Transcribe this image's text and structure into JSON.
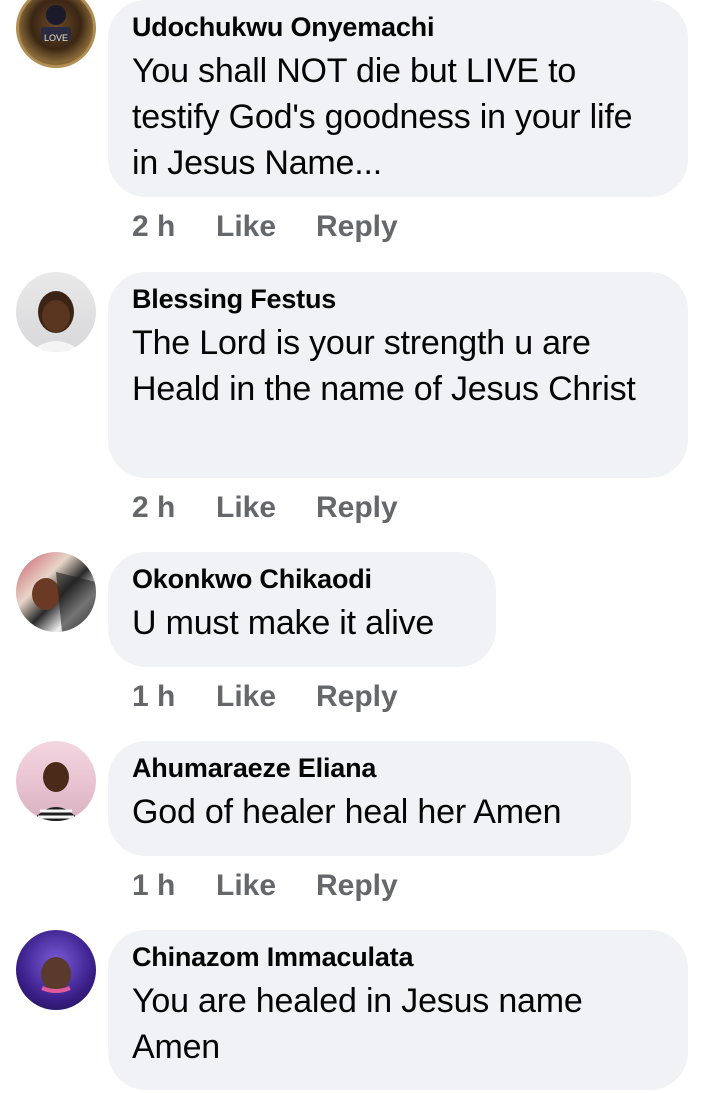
{
  "comments": [
    {
      "author": "Udochukwu Onyemachi",
      "text": "You shall NOT die but LIVE to testify God's goodness in your life in Jesus Name...",
      "time": "2 h",
      "avatar_badge": "LOVE"
    },
    {
      "author": "Blessing Festus",
      "text": "The Lord is your strength u are Heald in the name of Jesus Christ",
      "time": "2 h"
    },
    {
      "author": "Okonkwo Chikaodi",
      "text": "U must make it alive",
      "time": "1 h"
    },
    {
      "author": "Ahumaraeze Eliana",
      "text": "God of healer heal her Amen",
      "time": "1 h"
    },
    {
      "author": "Chinazom Immaculata",
      "text": "You are healed in Jesus name Amen",
      "time": ""
    }
  ],
  "actions": {
    "like": "Like",
    "reply": "Reply"
  },
  "colors": {
    "bubble": "#f0f2f5",
    "meta": "#65676b",
    "text": "#050505"
  }
}
